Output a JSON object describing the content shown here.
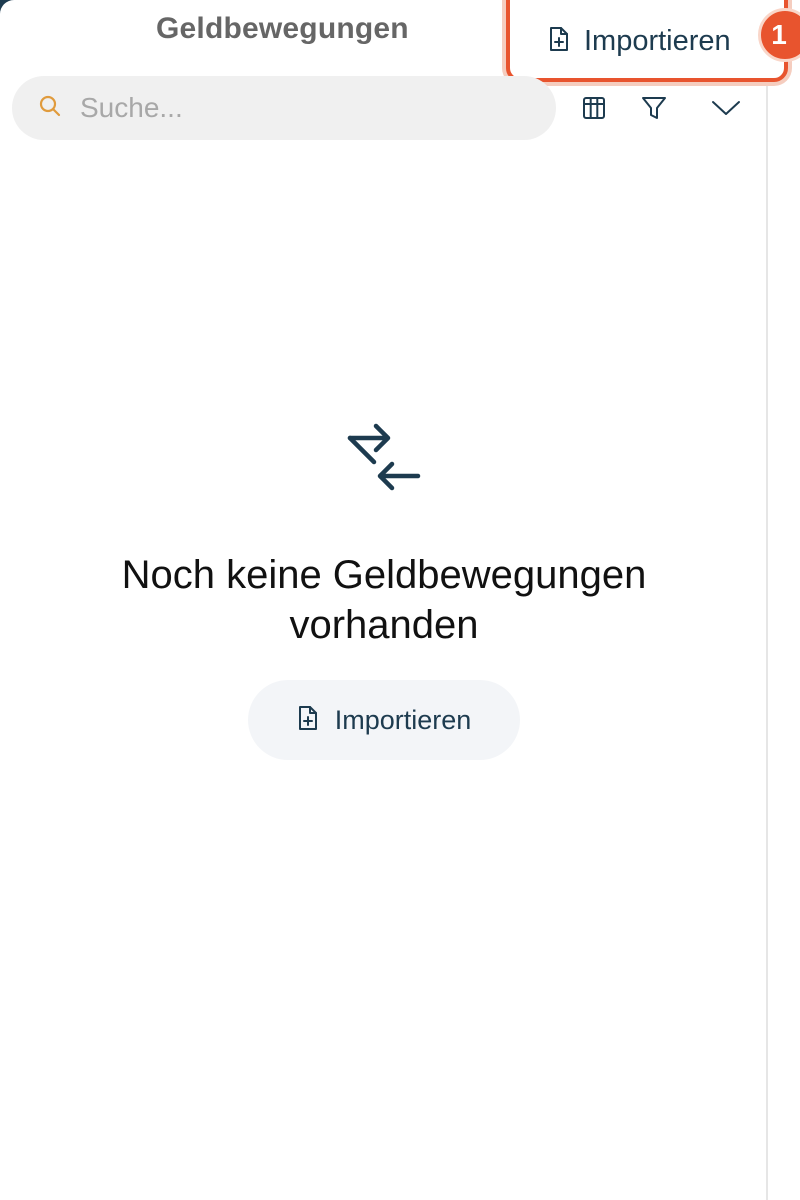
{
  "header": {
    "title": "Geldbewegungen",
    "import_label": "Importieren",
    "badge": "1"
  },
  "search": {
    "placeholder": "Suche...",
    "value": ""
  },
  "toolbar": {
    "icons": [
      "table-columns-icon",
      "filter-icon",
      "chevron-down-icon"
    ]
  },
  "empty_state": {
    "icon": "transfer-arrows-icon",
    "message": "Noch keine Geldbewegungen vorhanden",
    "import_label": "Importieren"
  },
  "colors": {
    "accent": "#e8542e",
    "primary_text": "#1d3b4f",
    "title_text": "#666666",
    "search_bg": "#f0f0f0",
    "search_icon": "#e09b3d"
  }
}
